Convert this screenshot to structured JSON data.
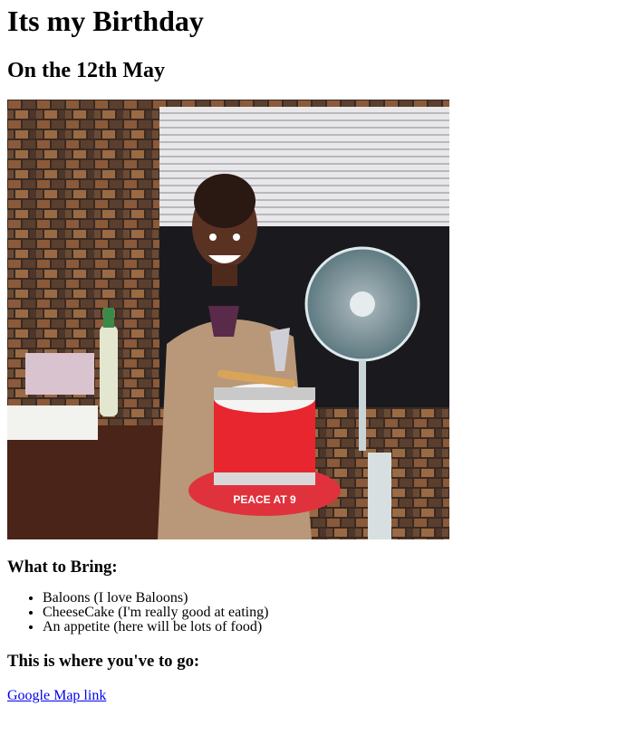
{
  "page": {
    "title": "Its my Birthday",
    "subtitle": "On the 12th May"
  },
  "photo": {
    "icon": "birthday-photo",
    "cake_text": "PEACE AT 9"
  },
  "bring": {
    "heading": "What to Bring:",
    "items": [
      "Baloons (I love Baloons)",
      "CheeseCake (I'm really good at eating)",
      "An appetite (here will be lots of food)"
    ]
  },
  "directions": {
    "heading": "This is where you've to go:",
    "link_label": "Google Map link"
  },
  "colors": {
    "link": "#0000ee",
    "text": "#000000",
    "background": "#ffffff"
  }
}
